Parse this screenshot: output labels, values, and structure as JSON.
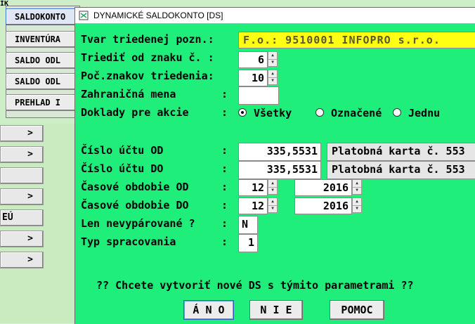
{
  "background_menu": {
    "top_cut_label": "ÍK",
    "items": [
      {
        "label": "SALDOKONTO"
      },
      {
        "label": "INVENTÚRA"
      },
      {
        "label": "SALDO ODL"
      },
      {
        "label": "SALDO ODL"
      },
      {
        "label": "PREHLAD I"
      }
    ],
    "left_buttons": [
      {
        "label": ">"
      },
      {
        "label": ">"
      },
      {
        "label": ""
      },
      {
        "label": ">"
      },
      {
        "label": "EÚ"
      },
      {
        "label": ">"
      },
      {
        "label": ">"
      }
    ]
  },
  "dialog": {
    "title": "DYNAMICKÉ SALDOKONTO  [DS]",
    "fields": {
      "tvar_label": "Tvar triedenej pozn.:",
      "tvar_value": "F.o.:   9510001 INFOPRO s.r.o.",
      "triedit_label": "Triediť od znaku č. :",
      "triedit_value": "6",
      "poc_label": "Poč.znakov triedenia:",
      "poc_value": "10",
      "mena_label": "Zahraničná mena",
      "mena_value": "",
      "doklady_label": "Doklady pre akcie",
      "ucet_od_label": "Číslo účtu OD",
      "ucet_od_value": "335,5531",
      "ucet_od_desc": "Platobná karta č. 553",
      "ucet_do_label": "Číslo účtu DO",
      "ucet_do_value": "335,5531",
      "ucet_do_desc": "Platobná karta č. 553",
      "obdobie_od_label": "Časové obdobie OD",
      "obdobie_od_month": "12",
      "obdobie_od_year": "2016",
      "obdobie_do_label": "Časové obdobie DO",
      "obdobie_do_month": "12",
      "obdobie_do_year": "2016",
      "nevyparovane_label": "Len nevypárované ?",
      "nevyparovane_value": "N",
      "typ_label": "Typ spracovania",
      "typ_value": "1"
    },
    "radio": [
      {
        "label": "Všetky",
        "selected": true
      },
      {
        "label": "Označené",
        "selected": false
      },
      {
        "label": "Jednu",
        "selected": false
      }
    ],
    "colon": ":",
    "question": "?? Chcete vytvoriť nové DS s týmito parametrami ??",
    "buttons": {
      "ano": "Á N O",
      "nie": "N I E",
      "pomoc": "POMOC"
    }
  }
}
